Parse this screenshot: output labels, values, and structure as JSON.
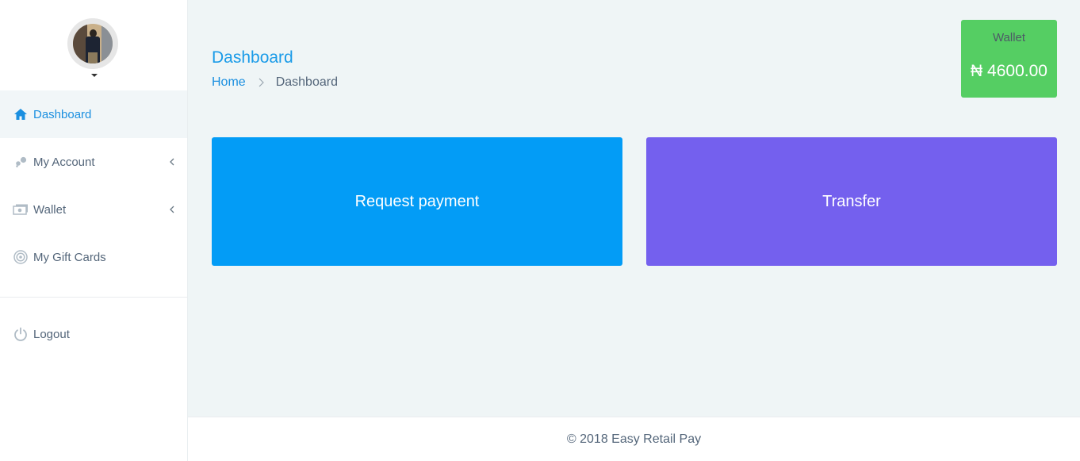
{
  "sidebar": {
    "items": [
      {
        "label": "Dashboard",
        "icon": "home-icon",
        "active": true
      },
      {
        "label": "My Account",
        "icon": "account-dots-icon",
        "has_submenu": true
      },
      {
        "label": "Wallet",
        "icon": "money-icon",
        "has_submenu": true
      },
      {
        "label": "My Gift Cards",
        "icon": "target-icon"
      }
    ],
    "logout": {
      "label": "Logout",
      "icon": "power-icon"
    }
  },
  "header": {
    "title": "Dashboard",
    "breadcrumb": {
      "home": "Home",
      "current": "Dashboard"
    }
  },
  "wallet": {
    "label": "Wallet",
    "value": "₦ 4600.00"
  },
  "actions": {
    "request_payment": "Request payment",
    "transfer": "Transfer"
  },
  "footer": {
    "text": "© 2018 Easy Retail Pay"
  },
  "colors": {
    "accent": "#1a8fe0",
    "wallet_bg": "#55ce63",
    "request_bg": "#039cf6",
    "transfer_bg": "#7460ee",
    "page_bg": "#eff5f6"
  }
}
